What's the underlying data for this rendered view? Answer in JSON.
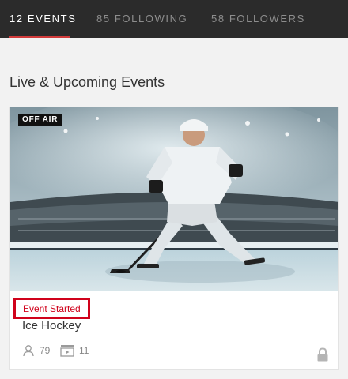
{
  "tabs": [
    {
      "label": "12 EVENTS",
      "active": true
    },
    {
      "label": "85 FOLLOWING",
      "active": false
    },
    {
      "label": "58 FOLLOWERS",
      "active": false
    }
  ],
  "section": {
    "title": "Live & Upcoming Events"
  },
  "event": {
    "badge": "OFF AIR",
    "status": "Event Started",
    "name": "Ice Hockey",
    "viewers": "79",
    "videos": "11",
    "icons": {
      "viewers": "user-icon",
      "videos": "video-playlist-icon",
      "locked": "lock-icon"
    }
  },
  "colors": {
    "accent": "#d23b3b",
    "status": "#d0021b",
    "topbar": "#2b2b2b"
  }
}
